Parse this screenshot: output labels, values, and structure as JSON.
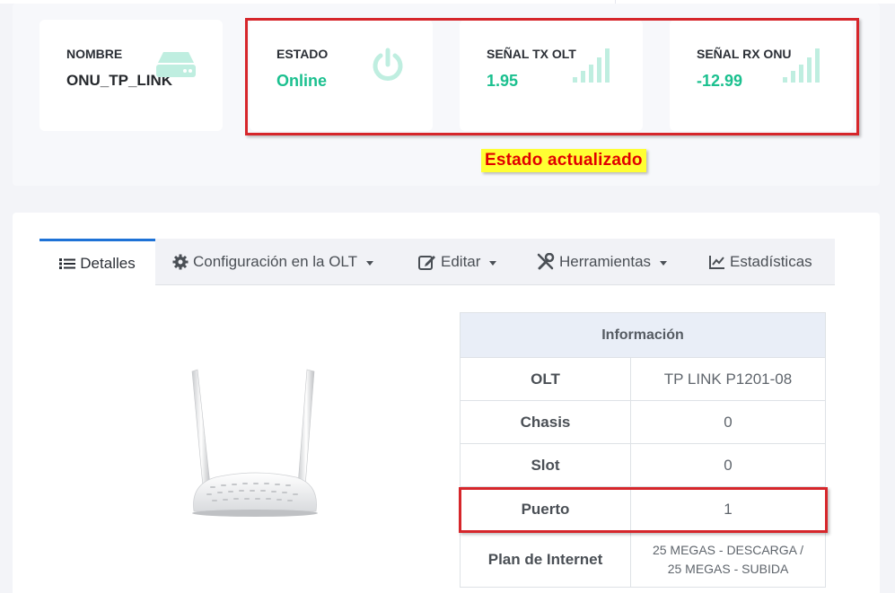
{
  "stats": {
    "nombre": {
      "label": "NOMBRE",
      "value": "ONU_TP_LINK",
      "icon": "router-icon"
    },
    "estado": {
      "label": "ESTADO",
      "value": "Online",
      "icon": "power-icon"
    },
    "tx": {
      "label": "SEÑAL TX OLT",
      "value": "1.95",
      "icon": "signal-bars-icon"
    },
    "rx": {
      "label": "SEÑAL RX ONU",
      "value": "-12.99",
      "icon": "signal-bars-icon"
    }
  },
  "annotation": {
    "text": "Estado actualizado"
  },
  "tabs": [
    {
      "label": "Detalles",
      "icon": "list-icon",
      "active": true
    },
    {
      "label": "Configuración en la OLT",
      "icon": "gear-icon",
      "dropdown": true
    },
    {
      "label": "Editar",
      "icon": "edit-icon",
      "dropdown": true
    },
    {
      "label": "Herramientas",
      "icon": "tools-icon",
      "dropdown": true
    },
    {
      "label": "Estadísticas",
      "icon": "chart-line-icon"
    }
  ],
  "info_table": {
    "header": "Información",
    "rows": [
      {
        "key": "OLT",
        "value": "TP LINK P1201-08"
      },
      {
        "key": "Chasis",
        "value": "0"
      },
      {
        "key": "Slot",
        "value": "0"
      },
      {
        "key": "Puerto",
        "value": "1"
      },
      {
        "key": "Plan de Internet",
        "value_line1": "25 MEGAS - DESCARGA /",
        "value_line2": "25 MEGAS - SUBIDA"
      }
    ]
  },
  "colors": {
    "accent_green": "#1bc08f",
    "highlight_red": "#d6262b",
    "highlight_yellow": "#ffff33",
    "tab_active_border": "#1e72d6"
  }
}
